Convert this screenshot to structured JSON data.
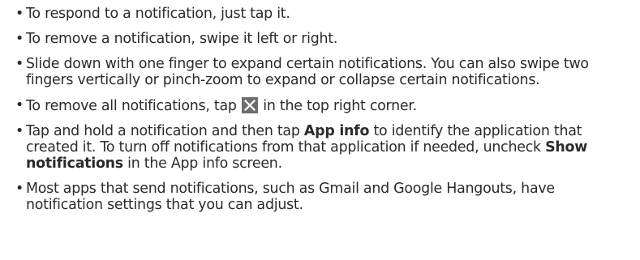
{
  "bullet_glyph": "•",
  "items": [
    {
      "text": "To respond to a notification, just tap it."
    },
    {
      "text": "To remove a notification, swipe it left or right."
    },
    {
      "text": "Slide down with one finger to expand certain notifications. You can also swipe two fingers vertically or pinch-zoom to expand or collapse certain notifications."
    },
    {
      "before": "To remove all notifications, tap ",
      "icon": "close-icon",
      "after": " in the top right corner."
    },
    {
      "t1": "Tap and hold a notification and then tap ",
      "b1": "App info",
      "t2": " to identify the application that created it. To turn off notifications from that application if needed, uncheck ",
      "b2": "Show notifications",
      "t3": " in the App info screen."
    },
    {
      "text": "Most apps that send notifications, such as Gmail and Google Hangouts, have notification settings that you can adjust."
    }
  ],
  "colors": {
    "text": "#2b2b2b",
    "icon_background": "#6e6e6e",
    "icon_glyph": "#ffffff"
  }
}
